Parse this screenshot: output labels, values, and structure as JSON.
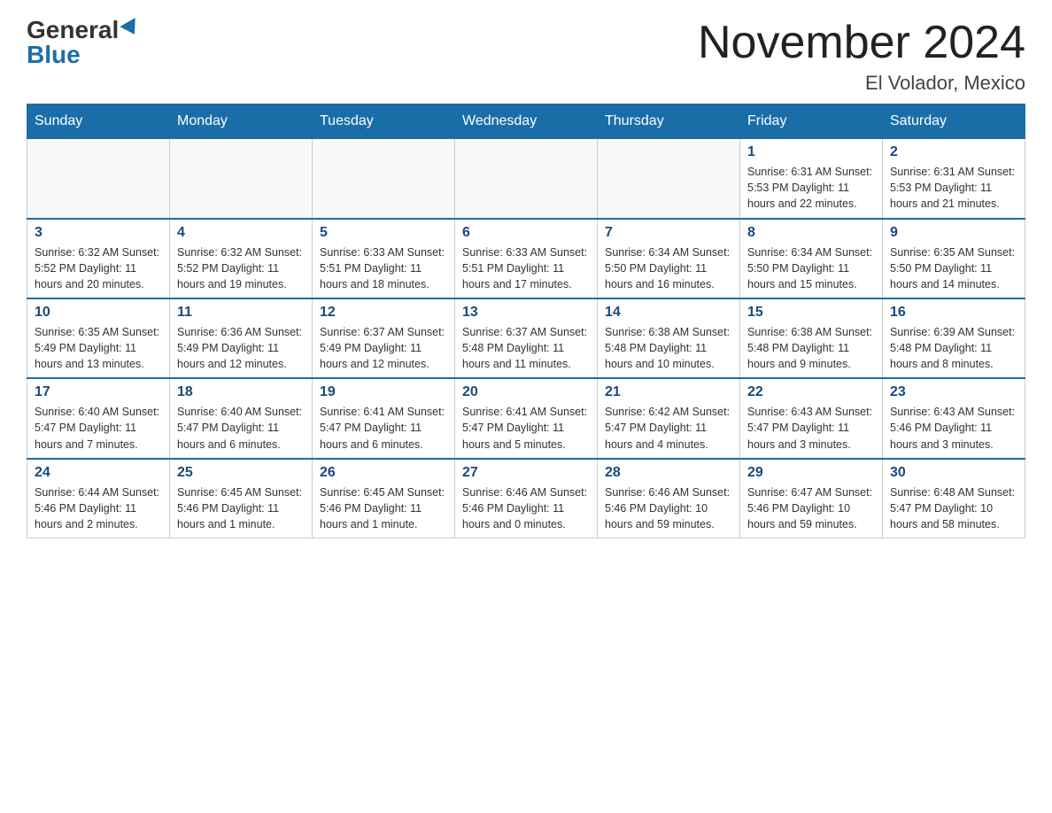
{
  "logo": {
    "general": "General",
    "blue": "Blue"
  },
  "title": {
    "month": "November 2024",
    "location": "El Volador, Mexico"
  },
  "weekdays": [
    "Sunday",
    "Monday",
    "Tuesday",
    "Wednesday",
    "Thursday",
    "Friday",
    "Saturday"
  ],
  "weeks": [
    [
      {
        "day": "",
        "info": ""
      },
      {
        "day": "",
        "info": ""
      },
      {
        "day": "",
        "info": ""
      },
      {
        "day": "",
        "info": ""
      },
      {
        "day": "",
        "info": ""
      },
      {
        "day": "1",
        "info": "Sunrise: 6:31 AM\nSunset: 5:53 PM\nDaylight: 11 hours and 22 minutes."
      },
      {
        "day": "2",
        "info": "Sunrise: 6:31 AM\nSunset: 5:53 PM\nDaylight: 11 hours and 21 minutes."
      }
    ],
    [
      {
        "day": "3",
        "info": "Sunrise: 6:32 AM\nSunset: 5:52 PM\nDaylight: 11 hours and 20 minutes."
      },
      {
        "day": "4",
        "info": "Sunrise: 6:32 AM\nSunset: 5:52 PM\nDaylight: 11 hours and 19 minutes."
      },
      {
        "day": "5",
        "info": "Sunrise: 6:33 AM\nSunset: 5:51 PM\nDaylight: 11 hours and 18 minutes."
      },
      {
        "day": "6",
        "info": "Sunrise: 6:33 AM\nSunset: 5:51 PM\nDaylight: 11 hours and 17 minutes."
      },
      {
        "day": "7",
        "info": "Sunrise: 6:34 AM\nSunset: 5:50 PM\nDaylight: 11 hours and 16 minutes."
      },
      {
        "day": "8",
        "info": "Sunrise: 6:34 AM\nSunset: 5:50 PM\nDaylight: 11 hours and 15 minutes."
      },
      {
        "day": "9",
        "info": "Sunrise: 6:35 AM\nSunset: 5:50 PM\nDaylight: 11 hours and 14 minutes."
      }
    ],
    [
      {
        "day": "10",
        "info": "Sunrise: 6:35 AM\nSunset: 5:49 PM\nDaylight: 11 hours and 13 minutes."
      },
      {
        "day": "11",
        "info": "Sunrise: 6:36 AM\nSunset: 5:49 PM\nDaylight: 11 hours and 12 minutes."
      },
      {
        "day": "12",
        "info": "Sunrise: 6:37 AM\nSunset: 5:49 PM\nDaylight: 11 hours and 12 minutes."
      },
      {
        "day": "13",
        "info": "Sunrise: 6:37 AM\nSunset: 5:48 PM\nDaylight: 11 hours and 11 minutes."
      },
      {
        "day": "14",
        "info": "Sunrise: 6:38 AM\nSunset: 5:48 PM\nDaylight: 11 hours and 10 minutes."
      },
      {
        "day": "15",
        "info": "Sunrise: 6:38 AM\nSunset: 5:48 PM\nDaylight: 11 hours and 9 minutes."
      },
      {
        "day": "16",
        "info": "Sunrise: 6:39 AM\nSunset: 5:48 PM\nDaylight: 11 hours and 8 minutes."
      }
    ],
    [
      {
        "day": "17",
        "info": "Sunrise: 6:40 AM\nSunset: 5:47 PM\nDaylight: 11 hours and 7 minutes."
      },
      {
        "day": "18",
        "info": "Sunrise: 6:40 AM\nSunset: 5:47 PM\nDaylight: 11 hours and 6 minutes."
      },
      {
        "day": "19",
        "info": "Sunrise: 6:41 AM\nSunset: 5:47 PM\nDaylight: 11 hours and 6 minutes."
      },
      {
        "day": "20",
        "info": "Sunrise: 6:41 AM\nSunset: 5:47 PM\nDaylight: 11 hours and 5 minutes."
      },
      {
        "day": "21",
        "info": "Sunrise: 6:42 AM\nSunset: 5:47 PM\nDaylight: 11 hours and 4 minutes."
      },
      {
        "day": "22",
        "info": "Sunrise: 6:43 AM\nSunset: 5:47 PM\nDaylight: 11 hours and 3 minutes."
      },
      {
        "day": "23",
        "info": "Sunrise: 6:43 AM\nSunset: 5:46 PM\nDaylight: 11 hours and 3 minutes."
      }
    ],
    [
      {
        "day": "24",
        "info": "Sunrise: 6:44 AM\nSunset: 5:46 PM\nDaylight: 11 hours and 2 minutes."
      },
      {
        "day": "25",
        "info": "Sunrise: 6:45 AM\nSunset: 5:46 PM\nDaylight: 11 hours and 1 minute."
      },
      {
        "day": "26",
        "info": "Sunrise: 6:45 AM\nSunset: 5:46 PM\nDaylight: 11 hours and 1 minute."
      },
      {
        "day": "27",
        "info": "Sunrise: 6:46 AM\nSunset: 5:46 PM\nDaylight: 11 hours and 0 minutes."
      },
      {
        "day": "28",
        "info": "Sunrise: 6:46 AM\nSunset: 5:46 PM\nDaylight: 10 hours and 59 minutes."
      },
      {
        "day": "29",
        "info": "Sunrise: 6:47 AM\nSunset: 5:46 PM\nDaylight: 10 hours and 59 minutes."
      },
      {
        "day": "30",
        "info": "Sunrise: 6:48 AM\nSunset: 5:47 PM\nDaylight: 10 hours and 58 minutes."
      }
    ]
  ]
}
